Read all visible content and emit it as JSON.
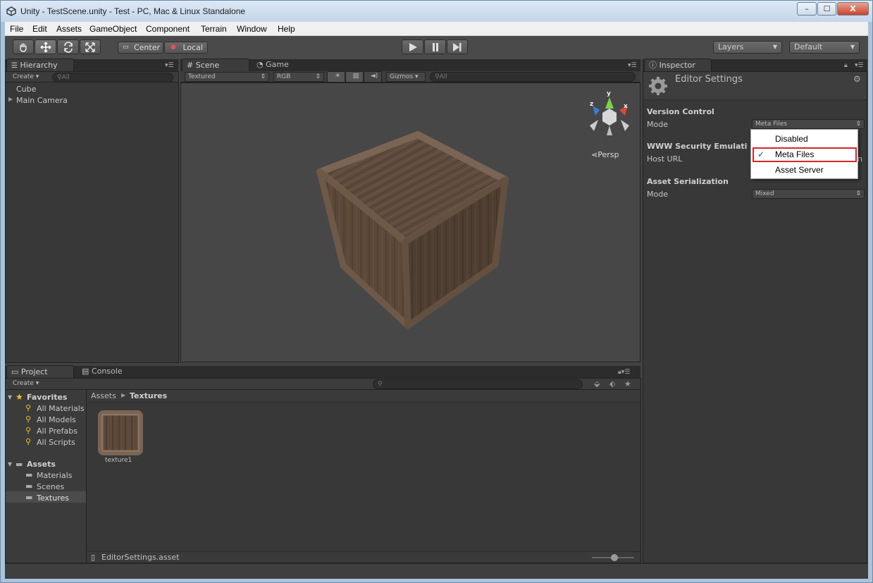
{
  "window": {
    "title": "Unity - TestScene.unity - Test - PC, Mac & Linux Standalone",
    "minimize": "–",
    "maximize": "☐",
    "close": "X"
  },
  "menu": [
    "File",
    "Edit",
    "Assets",
    "GameObject",
    "Component",
    "Terrain",
    "Window",
    "Help"
  ],
  "toolbar": {
    "pivot": "Center",
    "space": "Local",
    "layers": "Layers",
    "layout": "Default"
  },
  "hierarchy": {
    "tab": "Hierarchy",
    "create": "Create",
    "search_placeholder": "All",
    "items": [
      "Cube",
      "Main Camera"
    ]
  },
  "scene": {
    "tab_scene": "Scene",
    "tab_game": "Game",
    "render_mode": "Textured",
    "color_mode": "RGB",
    "gizmos": "Gizmos",
    "search_placeholder": "All",
    "persp": "Persp",
    "axis_x": "x",
    "axis_y": "y",
    "axis_z": "z"
  },
  "inspector": {
    "tab": "Inspector",
    "title": "Editor Settings",
    "version_control": {
      "heading": "Version Control",
      "mode_label": "Mode",
      "mode_value": "Meta Files"
    },
    "www": {
      "heading": "WWW Security Emulati",
      "host_label": "Host URL",
      "host_tail": "n"
    },
    "asset_serialization": {
      "heading": "Asset Serialization",
      "mode_label": "Mode",
      "mode_value": "Mixed"
    },
    "popup": {
      "items": [
        "Disabled",
        "Meta Files",
        "Asset Server"
      ],
      "checked": "Meta Files",
      "checkmark": "✓"
    }
  },
  "project": {
    "tab_project": "Project",
    "tab_console": "Console",
    "create": "Create",
    "favorites_label": "Favorites",
    "favorites": [
      "All Materials",
      "All Models",
      "All Prefabs",
      "All Scripts"
    ],
    "assets_label": "Assets",
    "folders": [
      "Materials",
      "Scenes",
      "Textures"
    ],
    "breadcrumb_root": "Assets",
    "breadcrumb_current": "Textures",
    "asset_name": "texture1",
    "status_file": "EditorSettings.asset"
  },
  "colors": {
    "highlight_box": "#d6262b",
    "selected_row": "#4b4b4b"
  }
}
